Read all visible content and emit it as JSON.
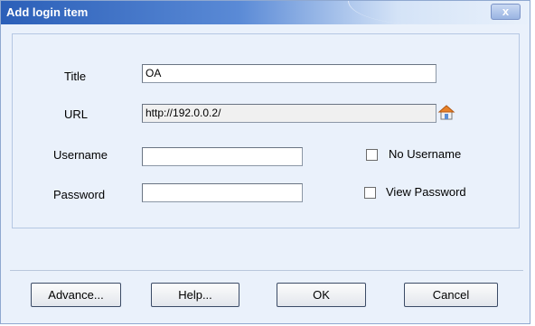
{
  "window": {
    "title": "Add login item",
    "close_glyph": "x"
  },
  "form": {
    "title_label": "Title",
    "title_value": "OA",
    "url_label": "URL",
    "url_value": "http://192.0.0.2/",
    "username_label": "Username",
    "username_value": "",
    "password_label": "Password",
    "password_value": "",
    "no_username_label": "No Username",
    "no_username_checked": false,
    "view_password_label": "View Password",
    "view_password_checked": false,
    "url_action_icon": "home-icon"
  },
  "buttons": {
    "advance": "Advance...",
    "help": "Help...",
    "ok": "OK",
    "cancel": "Cancel"
  },
  "colors": {
    "titlebar": "#2b5fb8",
    "dialog_bg": "#eaf1fb"
  }
}
